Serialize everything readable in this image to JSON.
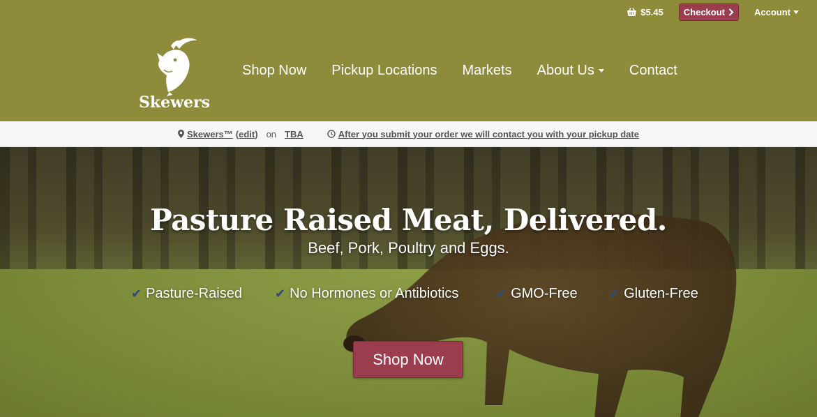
{
  "util": {
    "cart_amount": "$5.45",
    "checkout_label": "Checkout",
    "account_label": "Account"
  },
  "logo": {
    "text": "Skewers"
  },
  "nav": [
    {
      "label": "Shop Now"
    },
    {
      "label": "Pickup Locations"
    },
    {
      "label": "Markets"
    },
    {
      "label": "About Us"
    },
    {
      "label": "Contact"
    }
  ],
  "infobar": {
    "location": "Skewers™",
    "edit": "(edit)",
    "on": "on",
    "date": "TBA",
    "notice": "After you submit your order we will contact you with your pickup date"
  },
  "hero": {
    "title": "Pasture Raised Meat, Delivered.",
    "subtitle": "Beef, Pork, Poultry and Eggs.",
    "features": [
      "Pasture-Raised",
      "No Hormones or Antibiotics",
      "GMO-Free",
      "Gluten-Free"
    ],
    "cta": "Shop Now"
  },
  "colors": {
    "header_bg": "#8e8b3b",
    "accent": "#9c3d4f",
    "check": "#2f4b7a"
  },
  "icons": {
    "cart": "basket-icon",
    "checkout_arrow": "chevron-right-icon",
    "account_caret": "caret-down-icon",
    "location": "map-marker-icon",
    "clock": "clock-icon",
    "feature_check": "check-icon"
  }
}
